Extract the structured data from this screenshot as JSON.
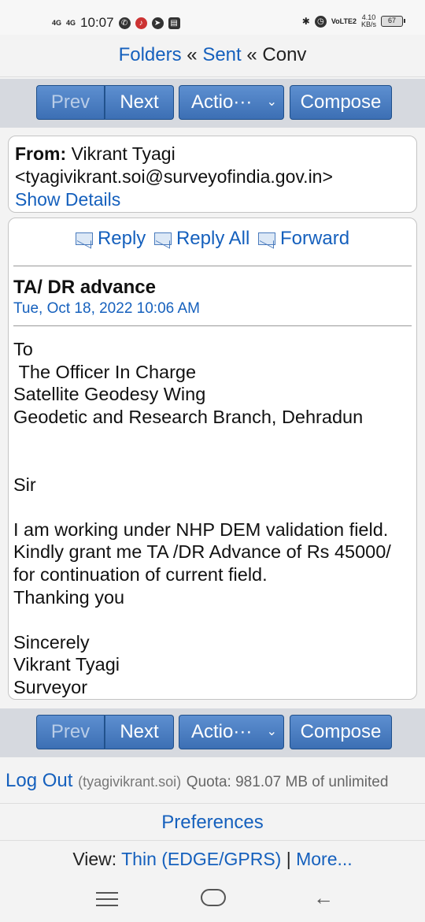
{
  "status_bar": {
    "net1": "4G",
    "net2": "4G",
    "time": "10:07",
    "volte": "VoLTE2",
    "speed_value": "4.10",
    "speed_unit": "KB/s",
    "battery": "67"
  },
  "breadcrumb": {
    "folders": "Folders",
    "sep": "«",
    "sent": "Sent",
    "conv": "Conv"
  },
  "toolbar": {
    "prev": "Prev",
    "next": "Next",
    "actions": "Actio···",
    "chevron": "⌄",
    "compose": "Compose"
  },
  "message": {
    "from_label": "From:",
    "from_name": "Vikrant Tyagi",
    "from_email": "<tyagivikrant.soi@surveyofindia.gov.in>",
    "show_details": "Show Details",
    "reply": "Reply",
    "reply_all": "Reply All",
    "forward": "Forward",
    "subject": "TA/ DR advance",
    "date": "Tue, Oct 18, 2022 10:06 AM",
    "body": "To\n The Officer In Charge\nSatellite Geodesy Wing\nGeodetic and Research Branch, Dehradun\n\n\nSir\n\nI am working under NHP DEM validation field. Kindly grant me TA /DR Advance of Rs 45000/  for continuation of current field.\nThanking you\n\nSincerely\nVikrant Tyagi\nSurveyor"
  },
  "footer": {
    "logout": "Log Out",
    "user": "(tyagivikrant.soi)",
    "quota": "Quota: 981.07 MB of unlimited",
    "preferences": "Preferences",
    "view_label": "View:",
    "view_mode": "Thin (EDGE/GPRS)",
    "view_sep": "|",
    "more": "More..."
  }
}
